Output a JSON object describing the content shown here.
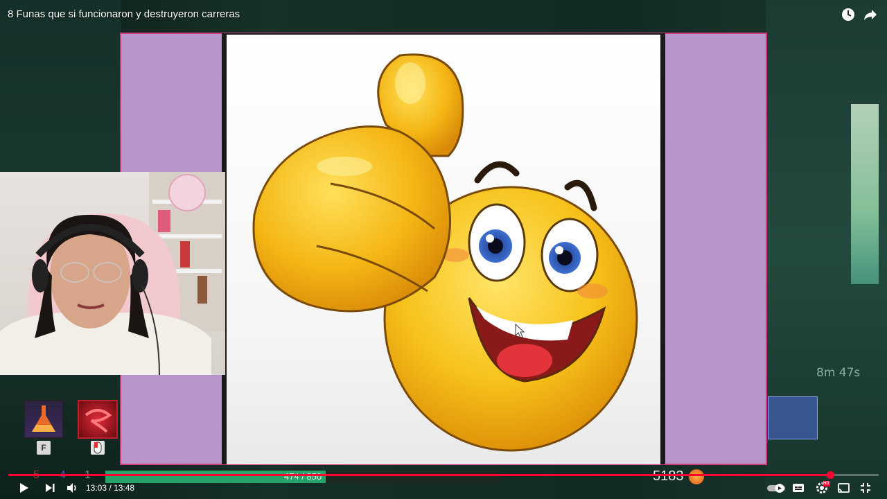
{
  "video": {
    "title": "8 Funas que si funcionaron y destruyeron carreras",
    "time_current": "13:03",
    "time_separator": "/",
    "time_total": "13:48",
    "played_fraction": 0.9447
  },
  "top_icons": {
    "watch_later": "clock-icon",
    "share": "share-arrow-icon"
  },
  "game_hud": {
    "run_timer": "8m 47s",
    "health_text": "474 / 850",
    "health_current": 474,
    "health_max": 850,
    "gold": "5183",
    "counters": [
      "5",
      "4",
      "1"
    ],
    "skill_key_left": "F"
  },
  "controls": {
    "play": "play-icon",
    "next": "next-icon",
    "volume": "volume-icon",
    "autoplay": "autoplay-toggle",
    "subtitles": "subtitles-icon",
    "settings": "settings-gear-icon",
    "settings_badge": "HD",
    "miniplayer": "cast-icon",
    "fullscreen_exit": "exit-fullscreen-icon"
  },
  "colors": {
    "accent": "#ff0033",
    "frame_pink": "#d23b7a",
    "frame_lilac": "#b896cc",
    "health_green": "#27a36a"
  }
}
